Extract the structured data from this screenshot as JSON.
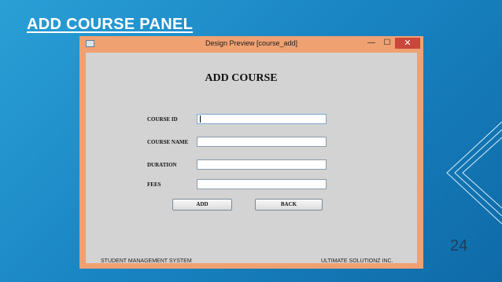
{
  "slide": {
    "title": "ADD COURSE PANEL",
    "page_number": "24"
  },
  "window": {
    "title": "Design Preview [course_add]",
    "controls": {
      "minimize": "—",
      "maximize": "☐",
      "close": "✕"
    }
  },
  "form": {
    "heading": "ADD COURSE",
    "fields": [
      {
        "label": "COURSE ID",
        "value": ""
      },
      {
        "label": "COURSE NAME",
        "value": ""
      },
      {
        "label": "DURATION",
        "value": ""
      },
      {
        "label": "FEES",
        "value": ""
      }
    ],
    "buttons": {
      "add": "ADD",
      "back": "BACK"
    }
  },
  "footer": {
    "left": "STUDENT MANAGEMENT SYSTEM",
    "right": "ULTIMATE SOLUTIONZ INC."
  }
}
